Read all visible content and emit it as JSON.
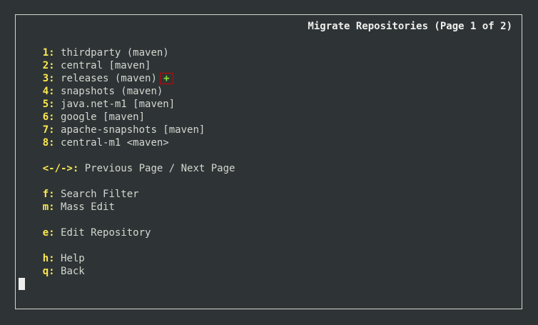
{
  "title": "Migrate Repositories (Page 1 of 2)",
  "repositories": [
    {
      "key": "1:",
      "label": "thirdparty (maven)"
    },
    {
      "key": "2:",
      "label": "central [maven]"
    },
    {
      "key": "3:",
      "label": "releases (maven)",
      "marker": "+"
    },
    {
      "key": "4:",
      "label": "snapshots (maven)"
    },
    {
      "key": "5:",
      "label": "java.net-m1 [maven]"
    },
    {
      "key": "6:",
      "label": "google [maven]"
    },
    {
      "key": "7:",
      "label": "apache-snapshots [maven]"
    },
    {
      "key": "8:",
      "label": "central-m1 <maven>"
    }
  ],
  "paging": {
    "key": "<-/->:",
    "label": "Previous Page / Next Page"
  },
  "commands": {
    "search_filter": {
      "key": "f:",
      "label": "Search Filter"
    },
    "mass_edit": {
      "key": "m:",
      "label": "Mass Edit"
    },
    "edit_repository": {
      "key": "e:",
      "label": "Edit Repository"
    },
    "help": {
      "key": "h:",
      "label": "Help"
    },
    "back": {
      "key": "q:",
      "label": "Back"
    }
  },
  "colors": {
    "background": "#2e3436",
    "text": "#d3d7cf",
    "key": "#fce94f",
    "marker_text": "#8ae234",
    "marker_border": "#cc0000"
  }
}
